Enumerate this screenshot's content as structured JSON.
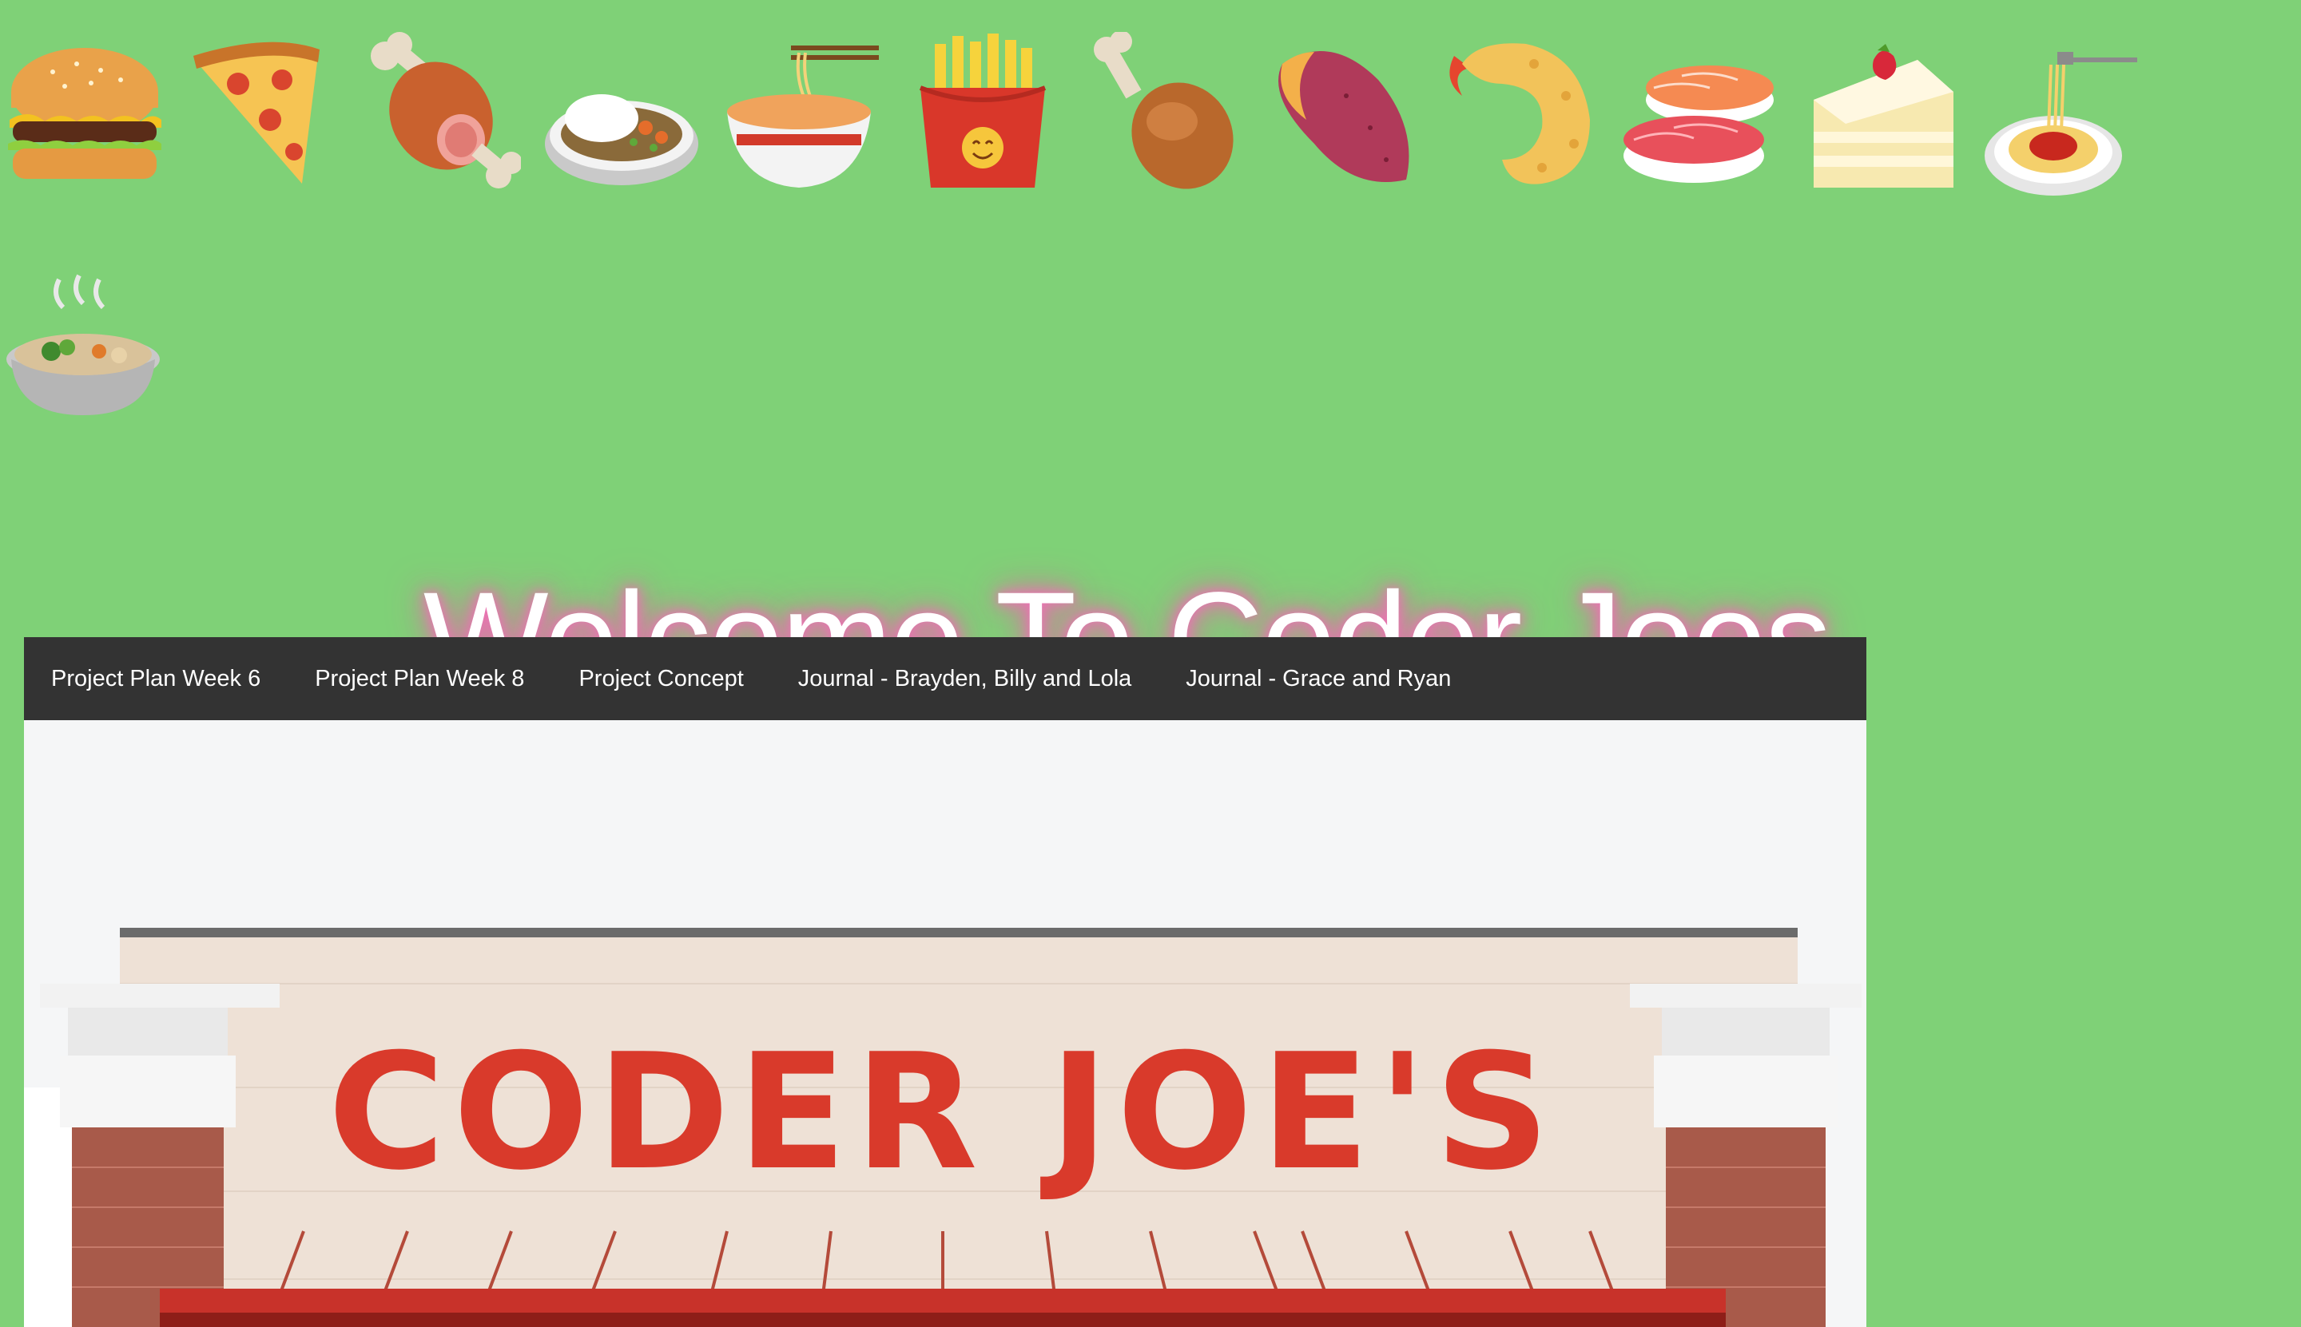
{
  "emojis": [
    {
      "name": "hamburger-icon"
    },
    {
      "name": "pizza-icon"
    },
    {
      "name": "meat-on-bone-icon"
    },
    {
      "name": "curry-rice-icon"
    },
    {
      "name": "ramen-icon"
    },
    {
      "name": "french-fries-icon"
    },
    {
      "name": "poultry-leg-icon"
    },
    {
      "name": "sweet-potato-icon"
    },
    {
      "name": "fried-shrimp-icon"
    },
    {
      "name": "sushi-icon"
    },
    {
      "name": "shortcake-icon"
    },
    {
      "name": "spaghetti-icon"
    },
    {
      "name": "stew-icon"
    }
  ],
  "header": {
    "title": "Welcome To Coder Joes"
  },
  "nav": {
    "items": [
      {
        "label": "Project Plan Week 6"
      },
      {
        "label": "Project Plan Week 8"
      },
      {
        "label": "Project Concept"
      },
      {
        "label": "Journal - Brayden, Billy and Lola"
      },
      {
        "label": "Journal - Grace and Ryan"
      }
    ]
  },
  "hero": {
    "sign_text": "CODER JOE'S"
  },
  "colors": {
    "background": "#7fd177",
    "nav_bg": "#333333",
    "title_glow": "#f06fb6",
    "sign_red": "#d93a2b"
  }
}
